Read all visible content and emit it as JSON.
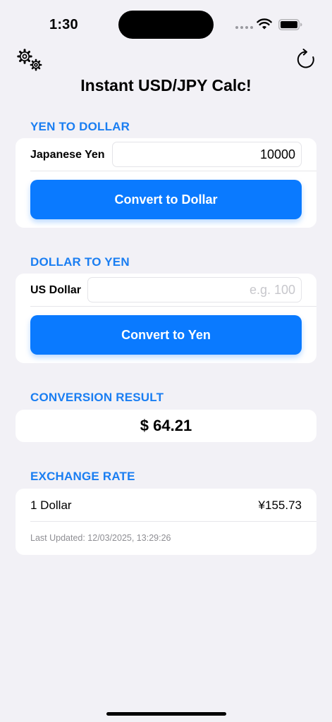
{
  "status": {
    "time": "1:30"
  },
  "header": {
    "title": "Instant USD/JPY Calc!"
  },
  "yen_to_dollar": {
    "header": "YEN TO DOLLAR",
    "label": "Japanese Yen",
    "value": "10000",
    "button": "Convert to Dollar"
  },
  "dollar_to_yen": {
    "header": "DOLLAR TO YEN",
    "label": "US Dollar",
    "placeholder": "e.g. 100",
    "button": "Convert to Yen"
  },
  "result": {
    "header": "CONVERSION RESULT",
    "value": "$ 64.21"
  },
  "exchange": {
    "header": "EXCHANGE RATE",
    "label": "1 Dollar",
    "rate": "¥155.73",
    "updated": "Last Updated: 12/03/2025, 13:29:26"
  },
  "colors": {
    "accent": "#0a7aff",
    "section_header": "#1a7ef2",
    "background": "#f2f1f6"
  },
  "icons": [
    "settings-gears-icon",
    "refresh-icon",
    "wifi-icon",
    "battery-icon",
    "cellular-signal-icon"
  ]
}
